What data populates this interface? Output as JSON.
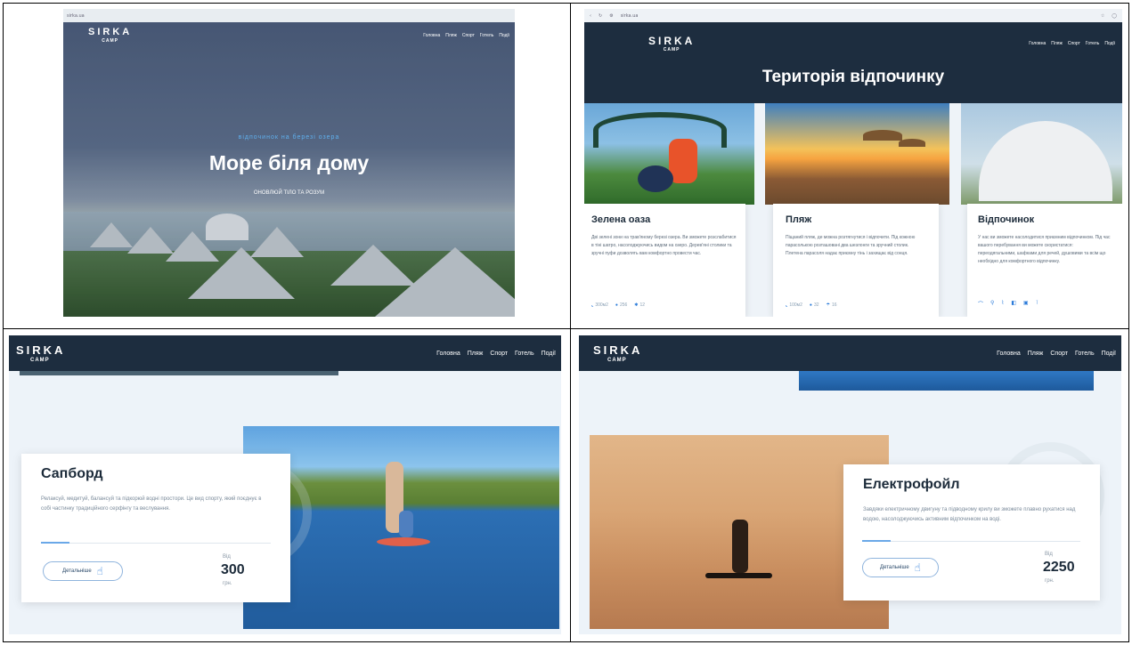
{
  "brand": {
    "name": "SIRKA",
    "sub": "CAMP"
  },
  "nav": [
    "Головна",
    "Пляж",
    "Спорт",
    "Готель",
    "Події"
  ],
  "browser": {
    "url_p1": "sirka.ua",
    "url_p2": "sirka.ua"
  },
  "hero": {
    "kicker": "відпочинок на березі озера",
    "title": "Море біля дому",
    "subtitle": "ОНОВЛЮЙ ТІЛО ТА РОЗУМ"
  },
  "territory": {
    "title": "Територія відпочинку",
    "cards": [
      {
        "title": "Зелена оаза",
        "text": "Дві зелені зони на трав'яному березі озера. Ви зможете розслабитися в тіні шатро, насолоджуючись видом на озеро. Дерев'яні столики та зручні пуфи дозволять вам комфортно провести час.",
        "stats": [
          "300м2",
          "256",
          "12"
        ]
      },
      {
        "title": "Пляж",
        "text": "Піщаний пляж, де можна розтягнутися і відпочити. Під кожною парасолькою розташовані два шезлонги та зручний столик. Плетена парасоля надає приємну тінь і захищає від сонця.",
        "stats": [
          "100м2",
          "32",
          "16"
        ]
      },
      {
        "title": "Відпочинок",
        "text": "У нас ви зможете насолодитися приємним відпочинком. Під час вашого перебування ви можете скористатися: переодягальними, шафками для речей, душовими та всім що необхідно для комфортного відпочинку."
      }
    ]
  },
  "sup": {
    "title": "Сапборд",
    "text": "Релаксуй, медитуй, балансуй та підкорюй водні простори. Це вид спорту, який поєднує в собі частинку традиційного серфінгу та веслування.",
    "details_label": "Детальніше",
    "price_from": "Від",
    "price": "300",
    "currency": "грн."
  },
  "efoil": {
    "title": "Електрофойл",
    "text": "Завдяки електричному двигуну та підводному крилу ви зможете плавно рухатися над водою, насолоджуючись активним відпочинком на воді.",
    "details_label": "Детальніше",
    "price_from": "Від",
    "price": "2250",
    "currency": "грн."
  },
  "colors": {
    "dark": "#1d2d3f",
    "accent": "#2b7bd9",
    "bg": "#edf3f9"
  }
}
